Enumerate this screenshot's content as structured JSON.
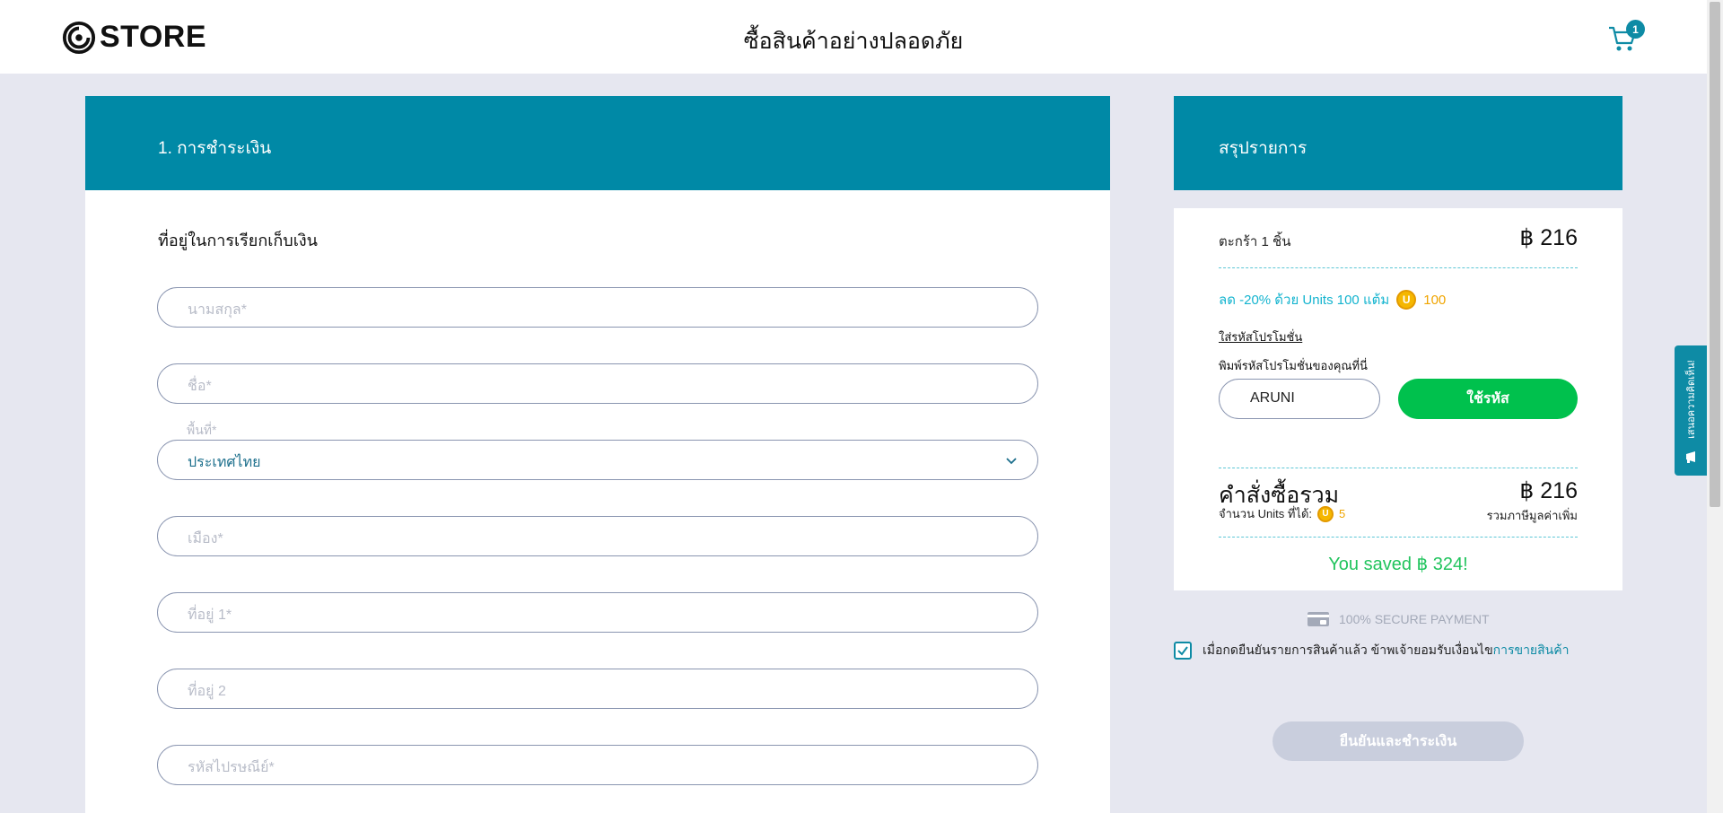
{
  "header": {
    "logo_text": "STORE",
    "title": "ซื้อสินค้าอย่างปลอดภัย",
    "cart_count": "1"
  },
  "feedback": {
    "label": "เสนอความคิดเห็น!"
  },
  "payment": {
    "heading": "1. การชำระเงิน",
    "section_title": "ที่อยู่ในการเรียกเก็บเงิน",
    "fields": {
      "last_name_placeholder": "นามสกุล*",
      "first_name_placeholder": "ชื่อ*",
      "region_label": "พื้นที่*",
      "region_value": "ประเทศไทย",
      "city_placeholder": "เมือง*",
      "address1_placeholder": "ที่อยู่ 1*",
      "address2_placeholder": "ที่อยู่ 2",
      "postcode_placeholder": "รหัสไปรษณีย์*"
    }
  },
  "summary": {
    "heading": "สรุปรายการ",
    "cart_label": "ตะกร้า 1 ชิ้น",
    "cart_price": "฿ 216",
    "discount_text": "ลด -20% ด้วย Units 100 แต้ม",
    "discount_units": "100",
    "promo_link": "ใส่รหัสโปรโมชั่น",
    "promo_label": "พิมพ์รหัสโปรโมชั่นของคุณที่นี่",
    "promo_value": "ARUNI",
    "promo_button": "ใช้รหัส",
    "total_label": "คำสั่งซื้อรวม",
    "total_price": "฿ 216",
    "earn_label": "จำนวน Units ที่ได้:",
    "earn_units": "5",
    "vat_label": "รวมภาษีมูลค่าเพิ่ม",
    "saved_text": "You saved ฿ 324!",
    "unit_icon_letter": "U"
  },
  "checkout": {
    "secure_text": "100% SECURE PAYMENT",
    "agree_text": "เมื่อกดยืนยันรายการสินค้าแล้ว ข้าพเจ้ายอมรับเงื่อนไข",
    "agree_link": "การขายสินค้า",
    "agree_checked": true,
    "confirm_button": "ยืนยันและชำระเงิน"
  },
  "colors": {
    "accent": "#0089a6",
    "promo_button": "#00c14d",
    "saved": "#22c45e",
    "units": "#f0a500",
    "disabled_button": "#c9cedd"
  }
}
